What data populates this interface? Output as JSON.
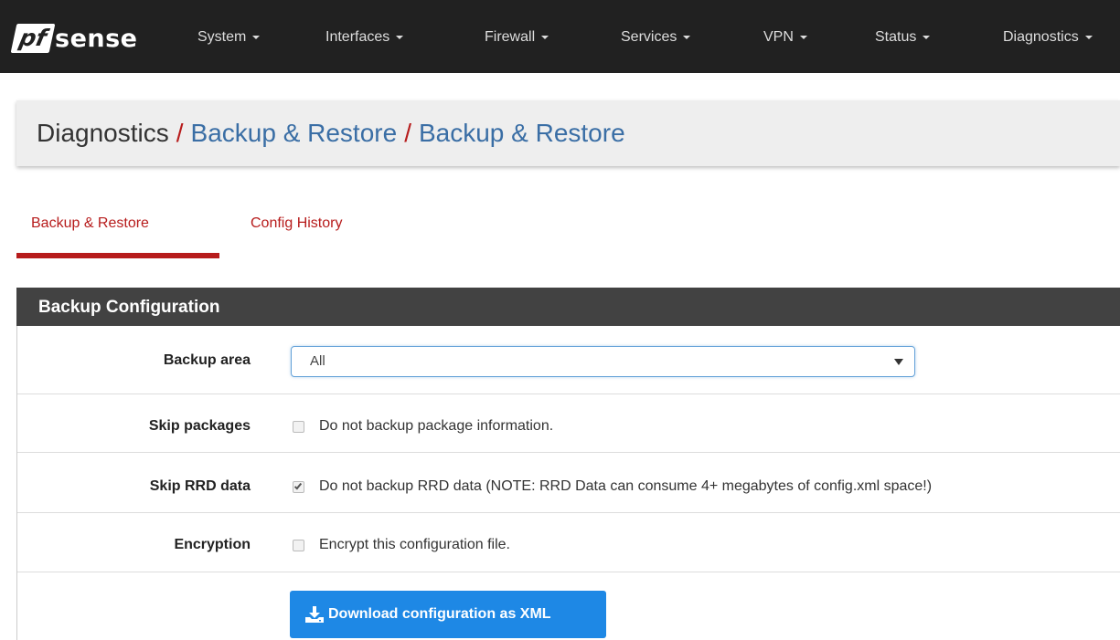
{
  "brand": {
    "logo_pf": "pf",
    "logo_sense": "sense"
  },
  "nav": {
    "items": [
      {
        "label": "System"
      },
      {
        "label": "Interfaces"
      },
      {
        "label": "Firewall"
      },
      {
        "label": "Services"
      },
      {
        "label": "VPN"
      },
      {
        "label": "Status"
      },
      {
        "label": "Diagnostics"
      }
    ]
  },
  "breadcrumb": {
    "root": "Diagnostics",
    "separator": "/",
    "level2": "Backup & Restore",
    "level3": "Backup & Restore"
  },
  "tabs": [
    {
      "label": "Backup & Restore",
      "active": true
    },
    {
      "label": "Config History",
      "active": false
    }
  ],
  "panel": {
    "title": "Backup Configuration",
    "backup_area": {
      "label": "Backup area",
      "value": "All"
    },
    "skip_packages": {
      "label": "Skip packages",
      "text": "Do not backup package information.",
      "checked": false
    },
    "skip_rrd": {
      "label": "Skip RRD data",
      "text": "Do not backup RRD data (NOTE: RRD Data can consume 4+ megabytes of config.xml space!)",
      "checked": true
    },
    "encryption": {
      "label": "Encryption",
      "text": "Encrypt this configuration file.",
      "checked": false
    },
    "download_button": {
      "label": "Download configuration as XML",
      "icon": "download-icon"
    }
  },
  "colors": {
    "navbar_bg": "#212121",
    "accent_red": "#b71c1c",
    "link_blue": "#3a6ea5",
    "panel_heading_bg": "#424242",
    "button_blue": "#1e88e5"
  }
}
